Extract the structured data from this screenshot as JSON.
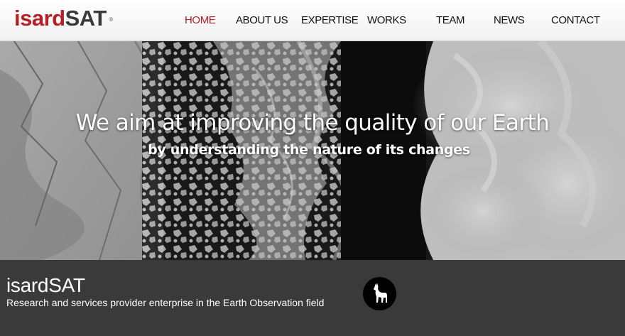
{
  "brand": {
    "name_part1": "isard",
    "name_part2": "SAT",
    "registered_mark": "®",
    "colors": {
      "red": "#b52025",
      "dark": "#3a3a3a"
    }
  },
  "nav": {
    "items": [
      {
        "label": "HOME",
        "active": true
      },
      {
        "label": "ABOUT US"
      },
      {
        "label": "EXPERTISE"
      },
      {
        "label": "WORKS"
      },
      {
        "label": "TEAM"
      },
      {
        "label": "NEWS"
      },
      {
        "label": "CONTACT"
      }
    ]
  },
  "hero": {
    "title": "We aim at improving the quality of our Earth",
    "subtitle": "by understanding the nature of its changes",
    "image": "satellite-sea-ice-image"
  },
  "band": {
    "title": "isardSAT",
    "description": "Research and services provider enterprise in the Earth Observation field",
    "icon": "chamois-icon"
  }
}
